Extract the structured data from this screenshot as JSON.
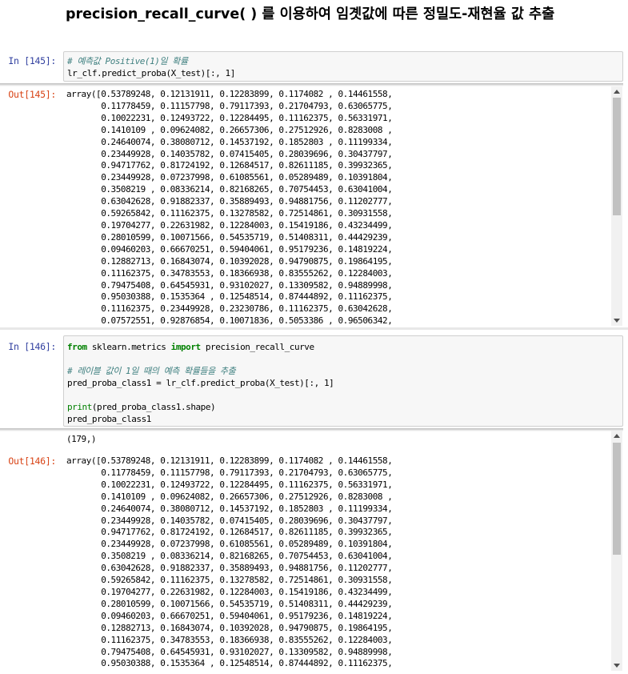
{
  "title": "precision_recall_curve( ) 를 이용하여 임곗값에 따른 정밀도-재현율 값 추출",
  "cells": [
    {
      "in_prompt": "In [145]:",
      "code": [
        {
          "type": "comment",
          "text": "# 예측값 Positive(1)일 확률"
        },
        {
          "type": "code",
          "text": "lr_clf.predict_proba(X_test)[:, 1]"
        }
      ],
      "out_prompt": "Out[145]:",
      "output_lines": [
        "array([0.53789248, 0.12131911, 0.12283899, 0.1174082 , 0.14461558,",
        "       0.11778459, 0.11157798, 0.79117393, 0.21704793, 0.63065775,",
        "       0.10022231, 0.12493722, 0.12284495, 0.11162375, 0.56331971,",
        "       0.1410109 , 0.09624082, 0.26657306, 0.27512926, 0.8283008 ,",
        "       0.24640074, 0.38080712, 0.14537192, 0.1852803 , 0.11199334,",
        "       0.23449928, 0.14035782, 0.07415405, 0.28039696, 0.30437797,",
        "       0.94717762, 0.81724192, 0.12684517, 0.82611185, 0.39932365,",
        "       0.23449928, 0.07237998, 0.61085561, 0.05289489, 0.10391804,",
        "       0.3508219 , 0.08336214, 0.82168265, 0.70754453, 0.63041004,",
        "       0.63042628, 0.91882337, 0.35889493, 0.94881756, 0.11202777,",
        "       0.59265842, 0.11162375, 0.13278582, 0.72514861, 0.30931558,",
        "       0.19704277, 0.22631982, 0.12284003, 0.15419186, 0.43234499,",
        "       0.28010599, 0.10071566, 0.54535719, 0.51408311, 0.44429239,",
        "       0.09460203, 0.66670251, 0.59404061, 0.95179236, 0.14819224,",
        "       0.12882713, 0.16843074, 0.10392028, 0.94790875, 0.19864195,",
        "       0.11162375, 0.34783553, 0.18366938, 0.83555262, 0.12284003,",
        "       0.79475408, 0.64545931, 0.93102027, 0.13309582, 0.94889998,",
        "       0.95030388, 0.1535364 , 0.12548514, 0.87444892, 0.11162375,",
        "       0.11162375, 0.23449928, 0.23230786, 0.11162375, 0.63042628,",
        "       0.07572551, 0.92876854, 0.10071836, 0.5053386 , 0.96506342,"
      ]
    },
    {
      "in_prompt": "In [146]:",
      "code_parts": {
        "from": "from",
        "module": " sklearn.metrics ",
        "import": "import",
        "name": " precision_recall_curve",
        "comment": "# 레이블 값이 1일 때의 예측 확률들을 추출",
        "line3": "pred_proba_class1 = lr_clf.predict_proba(X_test)[:, 1]",
        "print_fn": "print",
        "print_args": "(pred_proba_class1.shape)",
        "last_line": "pred_proba_class1"
      },
      "stream_output": "(179,)",
      "out_prompt": "Out[146]:",
      "output_lines": [
        "array([0.53789248, 0.12131911, 0.12283899, 0.1174082 , 0.14461558,",
        "       0.11778459, 0.11157798, 0.79117393, 0.21704793, 0.63065775,",
        "       0.10022231, 0.12493722, 0.12284495, 0.11162375, 0.56331971,",
        "       0.1410109 , 0.09624082, 0.26657306, 0.27512926, 0.8283008 ,",
        "       0.24640074, 0.38080712, 0.14537192, 0.1852803 , 0.11199334,",
        "       0.23449928, 0.14035782, 0.07415405, 0.28039696, 0.30437797,",
        "       0.94717762, 0.81724192, 0.12684517, 0.82611185, 0.39932365,",
        "       0.23449928, 0.07237998, 0.61085561, 0.05289489, 0.10391804,",
        "       0.3508219 , 0.08336214, 0.82168265, 0.70754453, 0.63041004,",
        "       0.63042628, 0.91882337, 0.35889493, 0.94881756, 0.11202777,",
        "       0.59265842, 0.11162375, 0.13278582, 0.72514861, 0.30931558,",
        "       0.19704277, 0.22631982, 0.12284003, 0.15419186, 0.43234499,",
        "       0.28010599, 0.10071566, 0.54535719, 0.51408311, 0.44429239,",
        "       0.09460203, 0.66670251, 0.59404061, 0.95179236, 0.14819224,",
        "       0.12882713, 0.16843074, 0.10392028, 0.94790875, 0.19864195,",
        "       0.11162375, 0.34783553, 0.18366938, 0.83555262, 0.12284003,",
        "       0.79475408, 0.64545931, 0.93102027, 0.13309582, 0.94889998,",
        "       0.95030388, 0.1535364 , 0.12548514, 0.87444892, 0.11162375,"
      ]
    }
  ],
  "colors": {
    "in_prompt": "#303F9F",
    "out_prompt": "#D84315",
    "keyword": "#008000",
    "comment": "#408080"
  }
}
